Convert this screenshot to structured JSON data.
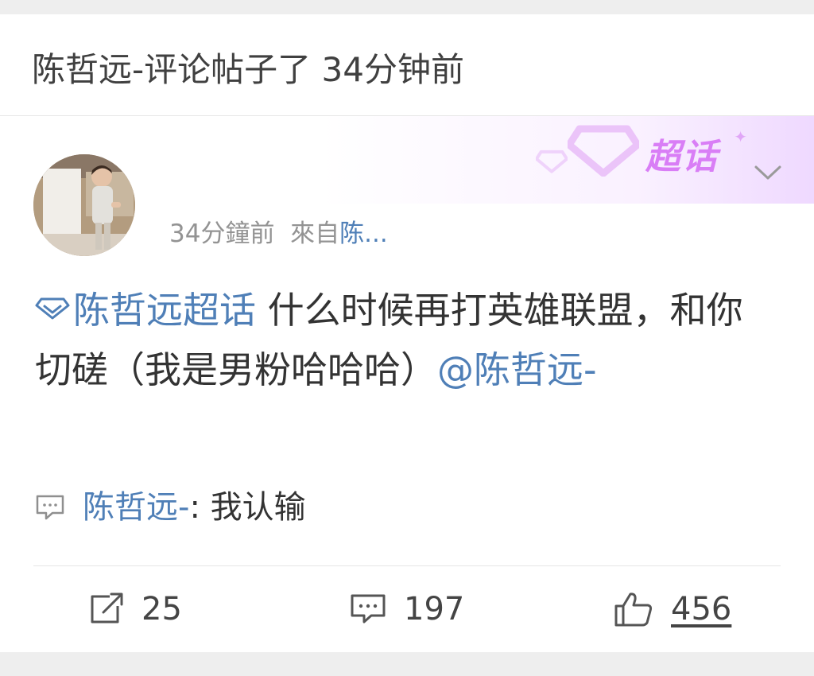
{
  "notification": {
    "text": "陈哲远-评论帖子了 34分钟前"
  },
  "supertopic": {
    "label": "超话",
    "accent_color": "#d97ef6"
  },
  "post": {
    "meta_time": "34分鐘前",
    "meta_from_label": "來自",
    "meta_source": "陈...",
    "topic_link": "陈哲远超话",
    "body": " 什么时候再打英雄联盟，和你切磋（我是男粉哈哈哈）",
    "mention": "@陈哲远-",
    "link_color": "#4f7fb7"
  },
  "comment": {
    "author": "陈哲远-",
    "separator": ": ",
    "text": "我认输"
  },
  "actions": {
    "repost_count": "25",
    "comment_count": "197",
    "like_count": "456"
  },
  "icons": {
    "topic": "diamond-icon",
    "comment": "comment-bubble-icon",
    "repost": "share-icon",
    "like": "thumbs-up-icon",
    "expand": "chevron-down-icon"
  }
}
